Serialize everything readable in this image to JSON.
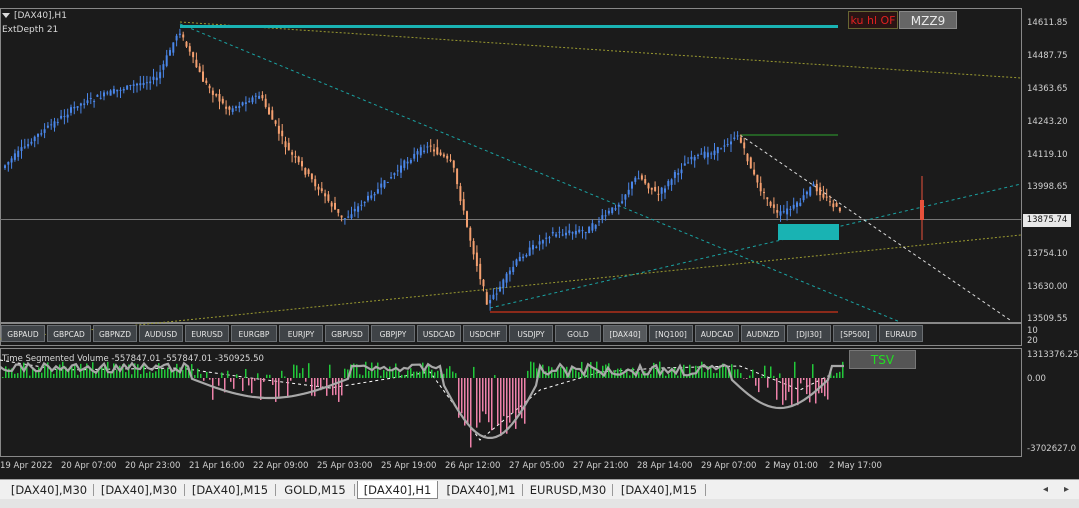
{
  "chart": {
    "title": "[DAX40],H1",
    "ext_label": "ExtDepth  21",
    "button_mzz": "MZZ9",
    "button_kuhl": "ku hl OF",
    "current_price": "13875.74",
    "price_axis": [
      "14611.85",
      "14487.75",
      "14363.65",
      "14243.20",
      "14119.10",
      "13998.65",
      "13754.10",
      "13630.00",
      "13509.55"
    ],
    "price_axis_minor": [
      "10",
      "20"
    ]
  },
  "symbols": [
    "GBPAUD",
    "GBPCAD",
    "GBPNZD",
    "AUDUSD",
    "EURUSD",
    "EURGBP",
    "EURJPY",
    "GBPUSD",
    "GBPJPY",
    "USDCAD",
    "USDCHF",
    "USDJPY",
    "GOLD",
    "[DAX40]",
    "[NQ100]",
    "AUDCAD",
    "AUDNZD",
    "[DJI30]",
    "[SP500]",
    "EURAUD"
  ],
  "active_symbol": "[DAX40]",
  "indicator": {
    "label": "Time Segmented Volume -557847.01 -557847.01 -350925.50",
    "button_tsv": "TSV",
    "axis": [
      "1313376.25",
      "0.00",
      "-3702627.0"
    ]
  },
  "time_axis": [
    "19 Apr 2022",
    "20 Apr 07:00",
    "20 Apr 23:00",
    "21 Apr 16:00",
    "22 Apr 09:00",
    "25 Apr 03:00",
    "25 Apr 19:00",
    "26 Apr 12:00",
    "27 Apr 05:00",
    "27 Apr 21:00",
    "28 Apr 14:00",
    "29 Apr 07:00",
    "2 May 01:00",
    "2 May 17:00"
  ],
  "tabs": [
    "[DAX40],M30",
    "[DAX40],M30",
    "[DAX40],M15",
    "GOLD,M15",
    "[DAX40],H1",
    "[DAX40],M1",
    "EURUSD,M30",
    "[DAX40],M15"
  ],
  "active_tab": "[DAX40],H1",
  "colors": {
    "background": "#1b1b1b",
    "bull": "#4a86e8",
    "bear": "#f4a070",
    "cyan": "#19b3b3",
    "volume_pos": "#22c93a",
    "volume_neg": "#ee82aa"
  }
}
